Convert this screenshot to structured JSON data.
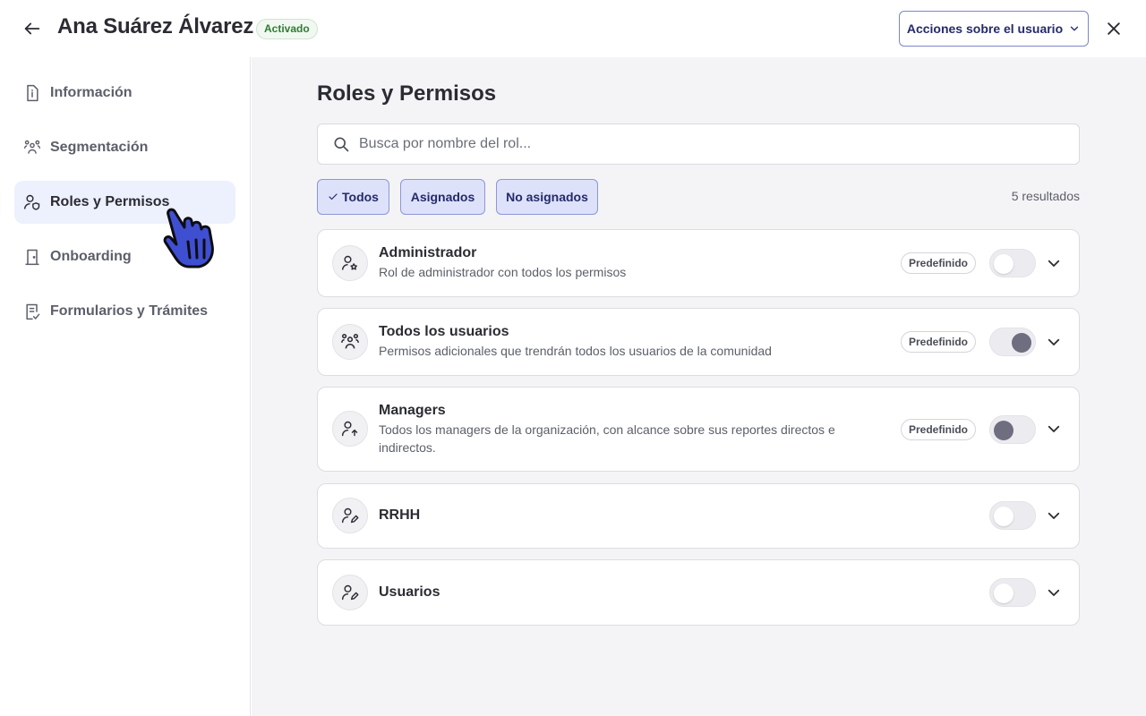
{
  "header": {
    "user_name": "Ana Suárez Álvarez",
    "status": "Activado",
    "actions_label": "Acciones sobre el usuario"
  },
  "sidebar": {
    "items": [
      {
        "label": "Información",
        "icon": "info-document-icon",
        "active": false
      },
      {
        "label": "Segmentación",
        "icon": "group-icon",
        "active": false
      },
      {
        "label": "Roles y Permisos",
        "icon": "user-shield-icon",
        "active": true
      },
      {
        "label": "Onboarding",
        "icon": "door-icon",
        "active": false
      },
      {
        "label": "Formularios y Trámites",
        "icon": "form-check-icon",
        "active": false
      }
    ]
  },
  "main": {
    "title": "Roles y Permisos",
    "search": {
      "placeholder": "Busca por nombre del rol...",
      "value": ""
    },
    "filters": [
      {
        "label": "Todos",
        "selected": true
      },
      {
        "label": "Asignados",
        "selected": false
      },
      {
        "label": "No asignados",
        "selected": false
      }
    ],
    "results": "5 resultados",
    "roles": [
      {
        "name": "Administrador",
        "description": "Rol de administrador con todos los permisos",
        "badge": "Predefinido",
        "toggle": "off",
        "icon": "user-star-icon"
      },
      {
        "name": "Todos los usuarios",
        "description": "Permisos adicionales que trendrán todos los usuarios de la comunidad",
        "badge": "Predefinido",
        "toggle": "on-disabled",
        "icon": "users-group-icon"
      },
      {
        "name": "Managers",
        "description": "Todos los managers de la organización, con alcance sobre sus reportes directos e indirectos.",
        "badge": "Predefinido",
        "toggle": "disabled",
        "icon": "user-up-icon"
      },
      {
        "name": "RRHH",
        "description": "",
        "badge": "",
        "toggle": "off",
        "icon": "user-edit-icon"
      },
      {
        "name": "Usuarios",
        "description": "",
        "badge": "",
        "toggle": "off",
        "icon": "user-edit-icon"
      }
    ]
  },
  "colors": {
    "accent": "#252a6b",
    "chip_bg": "#dde1fa",
    "active_nav_bg": "#edf0fd",
    "status_green": "#2e7d32",
    "main_bg": "#f4f4f6"
  }
}
